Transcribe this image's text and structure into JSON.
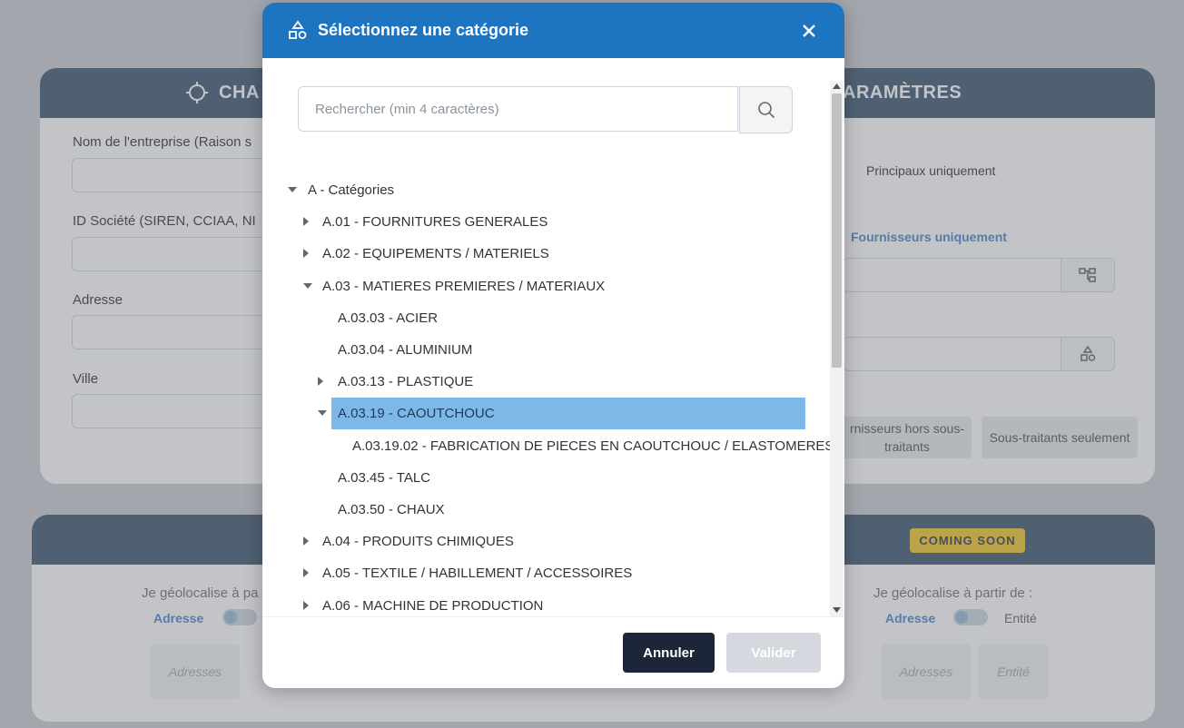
{
  "background": {
    "card1": {
      "title_left": "CHA",
      "title_right": "ARAMÈTRES",
      "labels": {
        "company_name": "Nom de l'entreprise (Raison s",
        "company_id": "ID Société (SIREN, CCIAA, NI",
        "address": "Adresse",
        "city": "Ville"
      },
      "principaux": "Principaux uniquement",
      "fournisseurs": "Fournisseurs uniquement",
      "chip_hors": "rnisseurs hors sous-traitants",
      "chip_sous": "Sous-traitants seulement"
    },
    "card2": {
      "coming_soon": "COMING SOON",
      "geo_left": "Je géolocalise à pa",
      "geo_right": "Je géolocalise à partir de :",
      "adresse_left": "Adresse",
      "adresse_right": "Adresse",
      "entite": "Entité",
      "adresses_left": "Adresses",
      "adresses_right": "Adresses",
      "entite_btn": "Entité"
    }
  },
  "modal": {
    "title": "Sélectionnez une catégorie",
    "search_placeholder": "Rechercher (min 4 caractères)",
    "tree": [
      {
        "label": "A - Catégories",
        "level": 0,
        "caret": "down"
      },
      {
        "label": "A.01 - FOURNITURES GENERALES",
        "level": 1,
        "caret": "right"
      },
      {
        "label": "A.02 - EQUIPEMENTS / MATERIELS",
        "level": 1,
        "caret": "right"
      },
      {
        "label": "A.03 - MATIERES PREMIERES / MATERIAUX",
        "level": 1,
        "caret": "down"
      },
      {
        "label": "A.03.03 - ACIER",
        "level": 2,
        "caret": "none"
      },
      {
        "label": "A.03.04 - ALUMINIUM",
        "level": 2,
        "caret": "none"
      },
      {
        "label": "A.03.13 - PLASTIQUE",
        "level": 2,
        "caret": "right"
      },
      {
        "label": "A.03.19 - CAOUTCHOUC",
        "level": 2,
        "caret": "down",
        "selected": true
      },
      {
        "label": "A.03.19.02 - FABRICATION DE PIECES EN CAOUTCHOUC / ELASTOMERES",
        "level": 3,
        "caret": "none"
      },
      {
        "label": "A.03.45 - TALC",
        "level": 2,
        "caret": "none"
      },
      {
        "label": "A.03.50 - CHAUX",
        "level": 2,
        "caret": "none"
      },
      {
        "label": "A.04 - PRODUITS CHIMIQUES",
        "level": 1,
        "caret": "right"
      },
      {
        "label": "A.05 - TEXTILE / HABILLEMENT / ACCESSOIRES",
        "level": 1,
        "caret": "right"
      },
      {
        "label": "A.06 - MACHINE DE PRODUCTION",
        "level": 1,
        "caret": "right"
      }
    ],
    "cancel_label": "Annuler",
    "validate_label": "Valider"
  }
}
